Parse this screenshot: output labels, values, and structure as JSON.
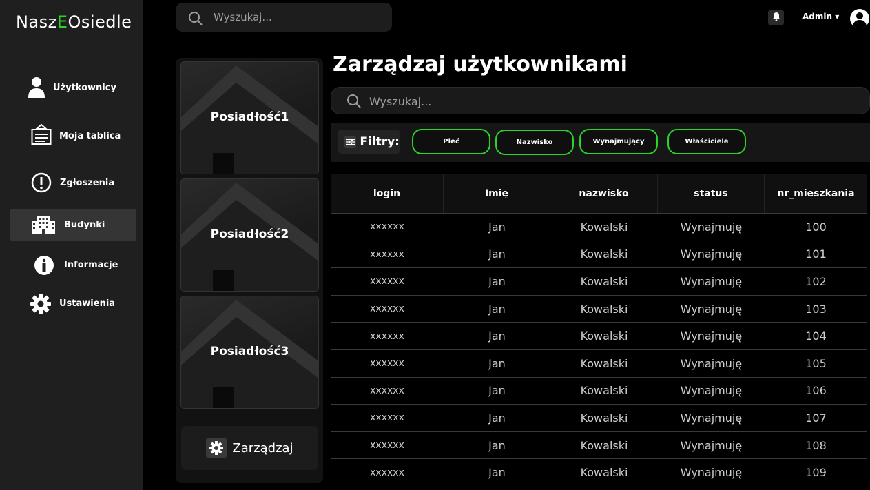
{
  "app": {
    "logo_prefix": "Nasz",
    "logo_accent": "E",
    "logo_suffix": "Osiedle",
    "accent_color": "#2bd32b"
  },
  "topbar": {
    "search_placeholder": "Wyszukaj...",
    "user_label": "Admin ▾"
  },
  "sidebar": {
    "items": [
      {
        "label": "Użytkownicy",
        "icon": "user-icon"
      },
      {
        "label": "Moja tablica",
        "icon": "board-icon"
      },
      {
        "label": "Zgłoszenia",
        "icon": "alert-icon"
      },
      {
        "label": "Budynki",
        "icon": "building-icon",
        "active": true
      },
      {
        "label": "Informacje",
        "icon": "info-icon"
      },
      {
        "label": "Ustawienia",
        "icon": "gear-icon"
      }
    ]
  },
  "properties": {
    "items": [
      {
        "label": "Posiadłość1"
      },
      {
        "label": "Posiadłość2"
      },
      {
        "label": "Posiadłość3"
      }
    ],
    "manage_label": "Zarządzaj"
  },
  "main": {
    "title": "Zarządzaj użytkownikami",
    "search_placeholder": "Wyszukaj...",
    "filters_label": "Filtry:",
    "filter_chips": [
      "Płeć",
      "Nazwisko",
      "Wynajmujący",
      "Właściciele"
    ]
  },
  "table": {
    "columns": [
      "login",
      "Imię",
      "nazwisko",
      "status",
      "nr_mieszkania"
    ],
    "rows": [
      [
        "xxxxxx",
        "Jan",
        "Kowalski",
        "Wynajmuję",
        "100"
      ],
      [
        "xxxxxx",
        "Jan",
        "Kowalski",
        "Wynajmuję",
        "101"
      ],
      [
        "xxxxxx",
        "Jan",
        "Kowalski",
        "Wynajmuję",
        "102"
      ],
      [
        "xxxxxx",
        "Jan",
        "Kowalski",
        "Wynajmuję",
        "103"
      ],
      [
        "xxxxxx",
        "Jan",
        "Kowalski",
        "Wynajmuję",
        "104"
      ],
      [
        "xxxxxx",
        "Jan",
        "Kowalski",
        "Wynajmuję",
        "105"
      ],
      [
        "xxxxxx",
        "Jan",
        "Kowalski",
        "Wynajmuję",
        "106"
      ],
      [
        "xxxxxx",
        "Jan",
        "Kowalski",
        "Wynajmuję",
        "107"
      ],
      [
        "xxxxxx",
        "Jan",
        "Kowalski",
        "Wynajmuję",
        "108"
      ],
      [
        "xxxxxx",
        "Jan",
        "Kowalski",
        "Wynajmuję",
        "109"
      ]
    ]
  }
}
